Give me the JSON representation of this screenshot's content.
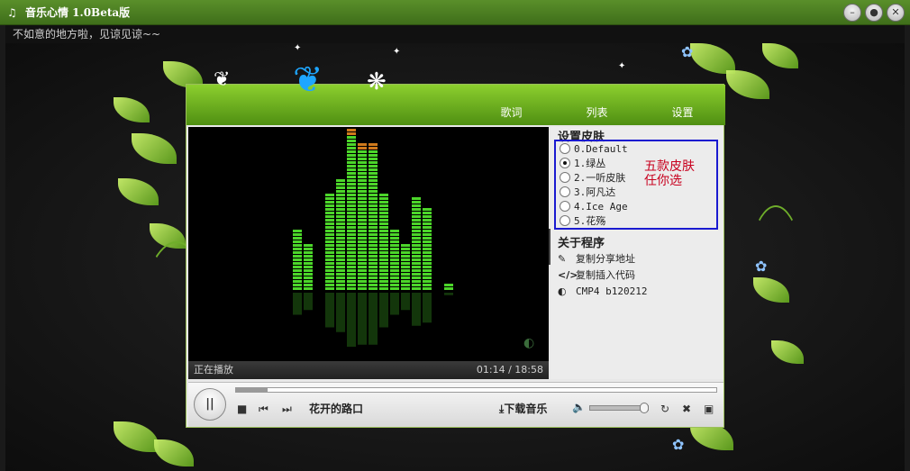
{
  "window": {
    "title": "音乐心情 1.0Beta版",
    "app_icon": "headphones-icon"
  },
  "marquee": "不如意的地方啦，见谅见谅~~",
  "nav": [
    {
      "label": "歌词"
    },
    {
      "label": "列表"
    },
    {
      "label": "设置"
    }
  ],
  "video": {
    "status_label": "正在播放",
    "time": "01:14 / 18:58"
  },
  "settings": {
    "skin_title": "设置皮肤",
    "skins": [
      {
        "label": "0.Default",
        "checked": false
      },
      {
        "label": "1.绿丛",
        "checked": true
      },
      {
        "label": "2.一听皮肤",
        "checked": false
      },
      {
        "label": "3.阿凡达",
        "checked": false
      },
      {
        "label": "4.Ice Age",
        "checked": false
      },
      {
        "label": "5.花殇",
        "checked": false
      }
    ],
    "skin_note_line1": "五款皮肤",
    "skin_note_line2": "任你选",
    "about_title": "关于程序",
    "about_items": [
      {
        "icon": "link-icon",
        "label": "复制分享地址"
      },
      {
        "icon": "code-icon",
        "label": "复制插入代码"
      },
      {
        "icon": "cmp-logo-icon",
        "label": "CMP4 b120212"
      }
    ]
  },
  "controls": {
    "song_title": "花开的路口",
    "download_label": "下载音乐",
    "progress": 0.065,
    "volume": 0.95
  },
  "colors": {
    "accent_green": "#6fae2a",
    "eq_green": "#4cd62a",
    "eq_peak": "#d07a1c",
    "highlight_box": "#1a1ad0",
    "note_red": "#c8001e"
  }
}
